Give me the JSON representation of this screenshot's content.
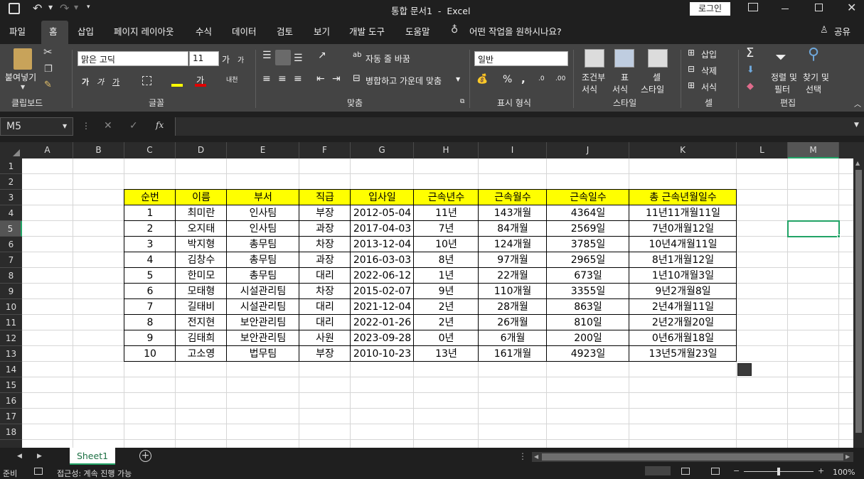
{
  "title": "통합 문서1  -  Excel",
  "login": "로그인",
  "tabs": [
    "파일",
    "홈",
    "삽입",
    "페이지 레이아웃",
    "수식",
    "데이터",
    "검토",
    "보기",
    "개발 도구",
    "도움말"
  ],
  "tellme": "어떤 작업을 원하시나요?",
  "share": "공유",
  "ribbon": {
    "paste": "붙여넣기",
    "clipboard": "클립보드",
    "font_name": "맑은 고딕",
    "font_size": "11",
    "font_group": "글꼴",
    "wrap": "자동 줄 바꿈",
    "merge": "병합하고 가운데 맞춤",
    "align_group": "맞춤",
    "number_format": "일반",
    "number_group": "표시 형식",
    "cond1": "조건부",
    "cond2": "서식",
    "table1": "표",
    "table2": "서식",
    "cellstyle1": "셀",
    "cellstyle2": "스타일",
    "style_group": "스타일",
    "insert": "삽입",
    "delete": "삭제",
    "format": "서식",
    "cells_group": "셀",
    "sort1": "정렬 및",
    "sort2": "필터",
    "find1": "찾기 및",
    "find2": "선택",
    "edit_group": "편집",
    "percent": "%",
    "comma": ","
  },
  "namebox": "M5",
  "fx": "fx",
  "columns": [
    "A",
    "B",
    "C",
    "D",
    "E",
    "F",
    "G",
    "H",
    "I",
    "J",
    "K",
    "L",
    "M"
  ],
  "rows": [
    "1",
    "2",
    "3",
    "4",
    "5",
    "6",
    "7",
    "8",
    "9",
    "10",
    "11",
    "12",
    "13",
    "14",
    "15",
    "16",
    "17",
    "18"
  ],
  "table": {
    "headers": [
      "순번",
      "이름",
      "부서",
      "직급",
      "입사일",
      "근속년수",
      "근속월수",
      "근속일수",
      "총 근속년월일수"
    ],
    "rows": [
      [
        "1",
        "최미란",
        "인사팀",
        "부장",
        "2012-05-04",
        "11년",
        "143개월",
        "4364일",
        "11년11개월11일"
      ],
      [
        "2",
        "오지태",
        "인사팀",
        "과장",
        "2017-04-03",
        "7년",
        "84개월",
        "2569일",
        "7년0개월12일"
      ],
      [
        "3",
        "박지형",
        "총무팀",
        "차장",
        "2013-12-04",
        "10년",
        "124개월",
        "3785일",
        "10년4개월11일"
      ],
      [
        "4",
        "김창수",
        "총무팀",
        "과장",
        "2016-03-03",
        "8년",
        "97개월",
        "2965일",
        "8년1개월12일"
      ],
      [
        "5",
        "한미모",
        "총무팀",
        "대리",
        "2022-06-12",
        "1년",
        "22개월",
        "673일",
        "1년10개월3일"
      ],
      [
        "6",
        "모태형",
        "시설관리팀",
        "차장",
        "2015-02-07",
        "9년",
        "110개월",
        "3355일",
        "9년2개월8일"
      ],
      [
        "7",
        "길태비",
        "시설관리팀",
        "대리",
        "2021-12-04",
        "2년",
        "28개월",
        "863일",
        "2년4개월11일"
      ],
      [
        "8",
        "전지현",
        "보안관리팀",
        "대리",
        "2022-01-26",
        "2년",
        "26개월",
        "810일",
        "2년2개월20일"
      ],
      [
        "9",
        "김태희",
        "보안관리팀",
        "사원",
        "2023-09-28",
        "0년",
        "6개월",
        "200일",
        "0년6개월18일"
      ],
      [
        "10",
        "고소영",
        "법무팀",
        "부장",
        "2010-10-23",
        "13년",
        "161개월",
        "4923일",
        "13년5개월23일"
      ]
    ]
  },
  "sheet_tab": "Sheet1",
  "status": {
    "ready": "준비",
    "accessibility": "접근성: 계속 진행 가능",
    "zoom": "100%"
  }
}
